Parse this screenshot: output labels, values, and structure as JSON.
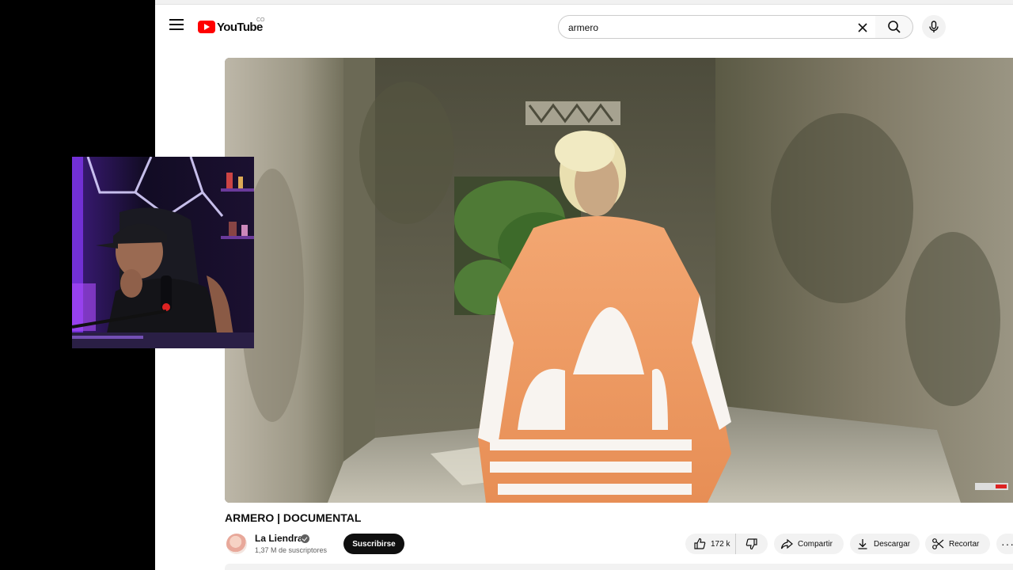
{
  "search": {
    "query": "armero",
    "region": "CO",
    "logo_text": "YouTube"
  },
  "video": {
    "title": "ARMERO | DOCUMENTAL",
    "channel": "La Liendra",
    "subscribers": "1,37 M de suscriptores",
    "subscribe_label": "Suscribirse",
    "likes": "172 k"
  },
  "actions": {
    "share": "Compartir",
    "download": "Descargar",
    "clip": "Recortar",
    "more": "···"
  },
  "colors": {
    "brand_red": "#ff0000",
    "jacket_orange": "#f0a06a"
  }
}
